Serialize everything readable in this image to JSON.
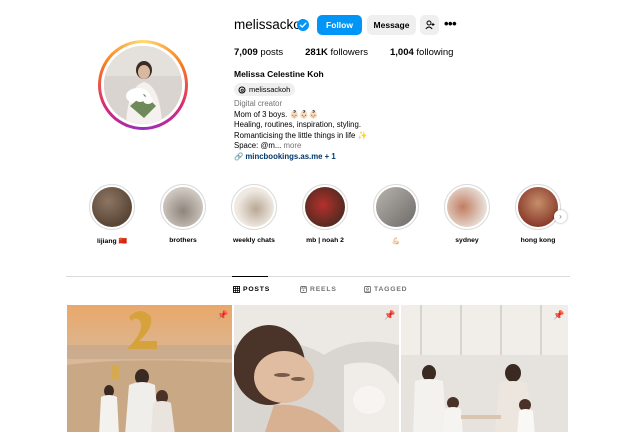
{
  "profile": {
    "username": "melissackoh",
    "follow_label": "Follow",
    "message_label": "Message",
    "stats": [
      {
        "count": "7,009",
        "label": "posts"
      },
      {
        "count": "281K",
        "label": "followers"
      },
      {
        "count": "1,004",
        "label": "following"
      }
    ],
    "full_name": "Melissa Celestine Koh",
    "threads_handle": "melissackoh",
    "category": "Digital creator",
    "bio_lines": [
      "Mom of 3 boys. 👶🏻👶🏻👶🏻",
      "Healing, routines, inspiration, styling.",
      "Romanticising the little things in life ✨"
    ],
    "bio_truncated": "Space: @m...",
    "more_label": "more",
    "link_text": "mincbookings.as.me + 1"
  },
  "highlights": [
    {
      "label": "lijiang 🇨🇳",
      "color_a": "#5a4636",
      "color_b": "#8d7563"
    },
    {
      "label": "brothers",
      "color_a": "#cfc8c0",
      "color_b": "#8e857c"
    },
    {
      "label": "weekly chats",
      "color_a": "#efe9e2",
      "color_b": "#b9a894"
    },
    {
      "label": "mb | noah 2",
      "color_a": "#b5302b",
      "color_b": "#4e2a21"
    },
    {
      "label": "💪🏻",
      "color_a": "#6c6a68",
      "color_b": "#b9b3ad"
    },
    {
      "label": "sydney",
      "color_a": "#c27d62",
      "color_b": "#e8e1da"
    },
    {
      "label": "hong kong",
      "color_a": "#8a3a2b",
      "color_b": "#c58f6a"
    }
  ],
  "tabs": {
    "posts": "POSTS",
    "reels": "REELS",
    "tagged": "TAGGED"
  },
  "colors": {
    "accent": "#0095f6",
    "button_gray": "#efefef",
    "secondary_text": "#737373",
    "link": "#00376b"
  }
}
